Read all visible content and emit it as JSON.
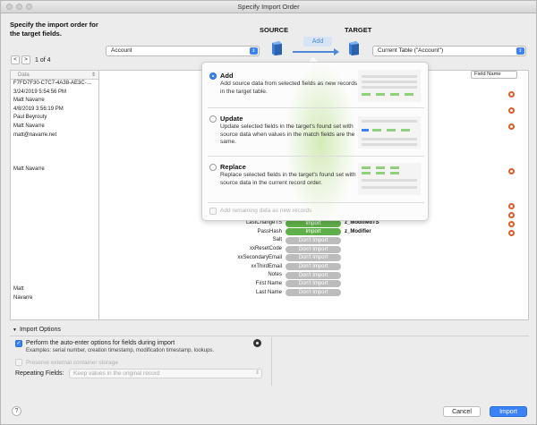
{
  "window": {
    "title": "Specify Import Order"
  },
  "header": {
    "instruction": "Specify the import order for the target fields.",
    "source_title": "SOURCE",
    "target_title": "TARGET",
    "mode_pill": "Add",
    "source_select": "Account",
    "target_select": "Current Table (\"Account\")"
  },
  "nav": {
    "record_label": "1 of 4",
    "prev": "<",
    "next": ">"
  },
  "source_panel": {
    "column_header": "Data",
    "rows": [
      "F7FD7F30-C7C7-4A38-AE3C-…",
      "3/24/2019 5:54:56 PM",
      "Matt Navarre",
      "4/8/2019 3:56:19 PM",
      "Paul Beyrouty",
      "Matt Navarre",
      "matt@navarre.net",
      "",
      "",
      "",
      "Matt Navarre",
      "",
      "",
      "",
      "",
      "",
      "",
      "",
      "",
      "",
      "",
      "",
      "",
      "",
      "Matt",
      "Navarre"
    ]
  },
  "target_panel": {
    "column_header": "Field Name"
  },
  "mappings": [
    {
      "source": "LastChangeTS",
      "action": "Import",
      "target": "z_ModifiedTS"
    },
    {
      "source": "PassHash",
      "action": "Import",
      "target": "z_Modifier"
    },
    {
      "source": "Salt",
      "action": "Don't Import",
      "target": ""
    },
    {
      "source": "xxResetCode",
      "action": "Don't Import",
      "target": ""
    },
    {
      "source": "xxSecondaryEmail",
      "action": "Don't Import",
      "target": ""
    },
    {
      "source": "xxThirdEmail",
      "action": "Don't Import",
      "target": ""
    },
    {
      "source": "Notes",
      "action": "Don't Import",
      "target": ""
    },
    {
      "source": "First Name",
      "action": "Don't Import",
      "target": ""
    },
    {
      "source": "Last Name",
      "action": "Don't Import",
      "target": ""
    }
  ],
  "popover": {
    "options": [
      {
        "title": "Add",
        "desc": "Add source data from selected fields as new records in the target table.",
        "selected": true
      },
      {
        "title": "Update",
        "desc": "Update selected fields in the target's found set with source data when values in the match fields are the same.",
        "selected": false
      },
      {
        "title": "Replace",
        "desc": "Replace selected fields in the target's found set with source data in the current record order.",
        "selected": false
      }
    ],
    "remaining_label": "Add remaining data as new records"
  },
  "import_options": {
    "section_title": "Import Options",
    "auto_enter_label": "Perform the auto-enter options for fields during import",
    "auto_enter_examples": "Examples: serial number, creation timestamp, modification timestamp, lookups.",
    "preserve_label": "Preserve external container storage",
    "repeating_label": "Repeating Fields:",
    "repeating_value": "Keep values in the original record"
  },
  "footer": {
    "help": "?",
    "cancel": "Cancel",
    "import": "Import"
  },
  "colors": {
    "accent": "#3b82f6",
    "import_green": "#5fb04a",
    "gear_orange": "#e05a26"
  }
}
